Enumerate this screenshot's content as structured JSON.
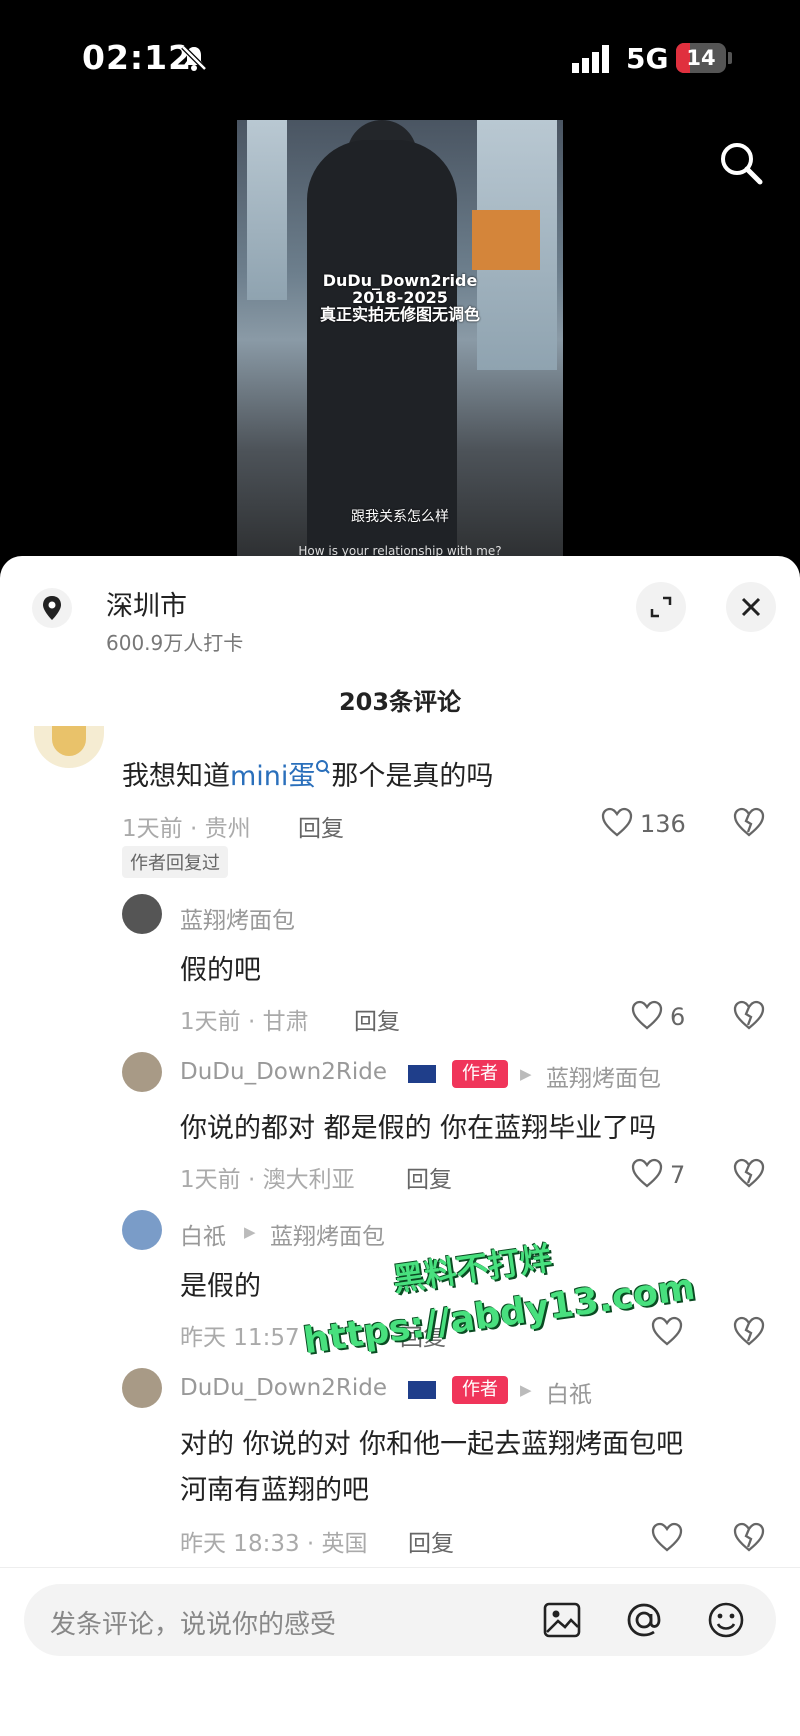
{
  "status": {
    "time": "02:12",
    "network": "5G",
    "battery": "14"
  },
  "video": {
    "overlay_title": "DuDu_Down2ride",
    "overlay_years": "2018-2025",
    "overlay_sub": "真正实拍无修图无调色",
    "caption_cn": "跟我关系怎么样",
    "caption_en": "How is your relationship with me?"
  },
  "location": {
    "name": "深圳市",
    "checkins": "600.9万人打卡"
  },
  "comments_count": "203条评论",
  "comments": [
    {
      "text_a": "我想知道",
      "text_link": "mini蛋",
      "text_b": "那个是真的吗",
      "meta": "1天前 · 贵州",
      "reply": "回复",
      "likes": "136",
      "tag": "作者回复过"
    },
    {
      "name": "蓝翔烤面包",
      "text": "假的吧",
      "meta": "1天前 · 甘肃",
      "reply": "回复",
      "likes": "6"
    },
    {
      "name": "DuDu_Down2Ride",
      "badge": "作者",
      "to": "蓝翔烤面包",
      "text": "你说的都对 都是假的 你在蓝翔毕业了吗",
      "meta": "1天前 · 澳大利亚",
      "reply": "回复",
      "likes": "7"
    },
    {
      "name": "白祇",
      "to": "蓝翔烤面包",
      "text": "是假的",
      "meta": "昨天 11:57",
      "reply": "回复",
      "likes": ""
    },
    {
      "name": "DuDu_Down2Ride",
      "badge": "作者",
      "to": "白祇",
      "text": "对的 你说的对 你和他一起去蓝翔烤面包吧",
      "text2": "河南有蓝翔的吧",
      "meta": "昨天 18:33 · 英国",
      "reply": "回复",
      "likes": ""
    }
  ],
  "watermark": {
    "line1": "黑料不打烊",
    "line2": "https://abdy13.com"
  },
  "input": {
    "placeholder": "发条评论，说说你的感受"
  },
  "icons": [
    "bell-slash-icon",
    "signal-icon",
    "search-icon",
    "location-pin-icon",
    "expand-icon",
    "close-icon",
    "heart-icon",
    "broken-heart-icon",
    "image-icon",
    "at-icon",
    "emoji-icon"
  ]
}
